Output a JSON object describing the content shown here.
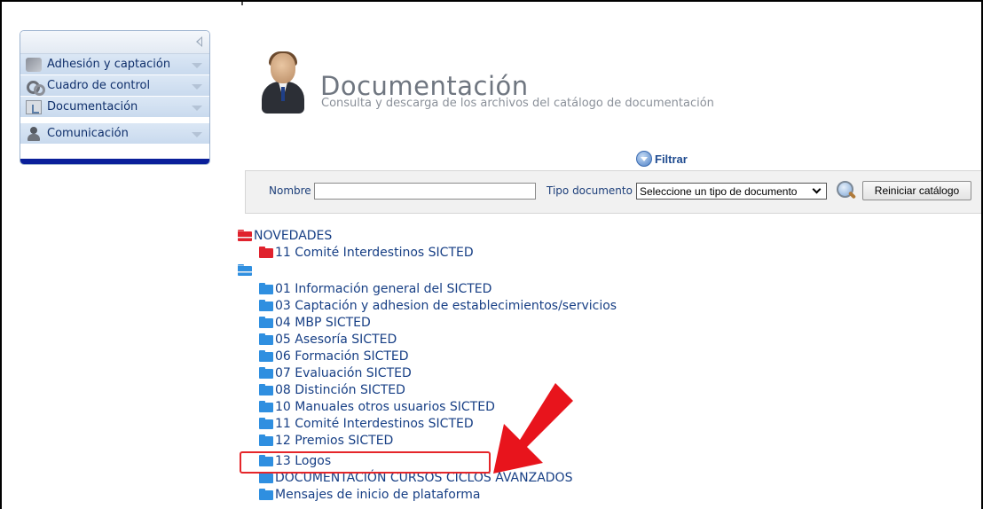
{
  "sidebar": {
    "items": [
      {
        "label": "Adhesión y captación",
        "icon": "handshake-icon"
      },
      {
        "label": "Cuadro de control",
        "icon": "gears-icon"
      },
      {
        "label": "Documentación",
        "icon": "document-icon"
      },
      {
        "label": "Comunicación",
        "icon": "person-icon"
      }
    ]
  },
  "header": {
    "title": "Documentación",
    "subtitle": "Consulta y descarga de los archivos del catálogo de documentación"
  },
  "filter": {
    "toggle_label": "Filtrar",
    "nombre_label": "Nombre",
    "nombre_value": "",
    "tipo_label": "Tipo documento",
    "tipo_selected": "Seleccione un tipo de documento",
    "reset_label": "Reiniciar catálogo"
  },
  "tree": {
    "novedades": {
      "label": "NOVEDADES",
      "children": [
        "11 Comité Interdestinos SICTED"
      ]
    },
    "root": {
      "label": "",
      "children": [
        "01 Información general del SICTED",
        "03 Captación y adhesion de establecimientos/servicios",
        "04 MBP SICTED",
        "05 Asesoría SICTED",
        "06 Formación SICTED",
        "07 Evaluación SICTED",
        "08 Distinción SICTED",
        "10 Manuales otros usuarios SICTED",
        "11 Comité Interdestinos SICTED",
        "12 Premios SICTED",
        "13 Logos",
        "DOCUMENTACIÓN CURSOS CICLOS AVANZADOS",
        "Mensajes de inicio de plataforma"
      ]
    }
  },
  "annotation": {
    "highlighted_item": "13 Logos",
    "highlight_color": "#e5262a"
  }
}
